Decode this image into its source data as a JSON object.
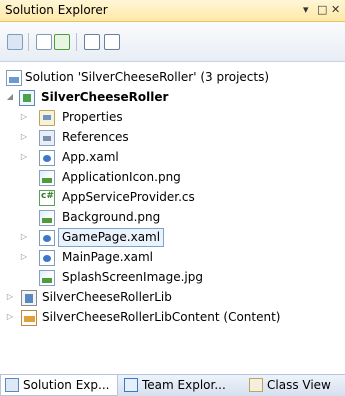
{
  "panel": {
    "title": "Solution Explorer",
    "pin_glyph": "▾",
    "restore_glyph": "□",
    "close_glyph": "✕"
  },
  "toolbar": {
    "buttons": [
      {
        "name": "properties-icon"
      },
      {
        "name": "show-all-files-icon"
      },
      {
        "name": "refresh-icon"
      },
      {
        "name": "view-code-icon"
      },
      {
        "name": "view-designer-icon"
      }
    ]
  },
  "tree": {
    "solution": "Solution 'SilverCheeseRoller' (3 projects)",
    "project": "SilverCheeseRoller",
    "items": [
      {
        "label": "Properties",
        "icon": "folder-icon",
        "expandable": true
      },
      {
        "label": "References",
        "icon": "references-icon",
        "expandable": true
      },
      {
        "label": "App.xaml",
        "icon": "xaml-file-icon",
        "expandable": true
      },
      {
        "label": "ApplicationIcon.png",
        "icon": "image-file-icon",
        "expandable": false
      },
      {
        "label": "AppServiceProvider.cs",
        "icon": "csharp-file-icon",
        "expandable": false
      },
      {
        "label": "Background.png",
        "icon": "image-file-icon",
        "expandable": false
      },
      {
        "label": "GamePage.xaml",
        "icon": "xaml-file-icon",
        "expandable": true,
        "selected": true
      },
      {
        "label": "MainPage.xaml",
        "icon": "xaml-file-icon",
        "expandable": true
      },
      {
        "label": "SplashScreenImage.jpg",
        "icon": "image-file-icon",
        "expandable": false
      }
    ],
    "other_projects": [
      {
        "label": "SilverCheeseRollerLib",
        "icon": "library-project-icon"
      },
      {
        "label": "SilverCheeseRollerLibContent (Content)",
        "icon": "content-project-icon"
      }
    ]
  },
  "tabs": [
    {
      "label": "Solution Exp...",
      "active": true
    },
    {
      "label": "Team Explor...",
      "active": false
    },
    {
      "label": "Class View",
      "active": false
    }
  ]
}
